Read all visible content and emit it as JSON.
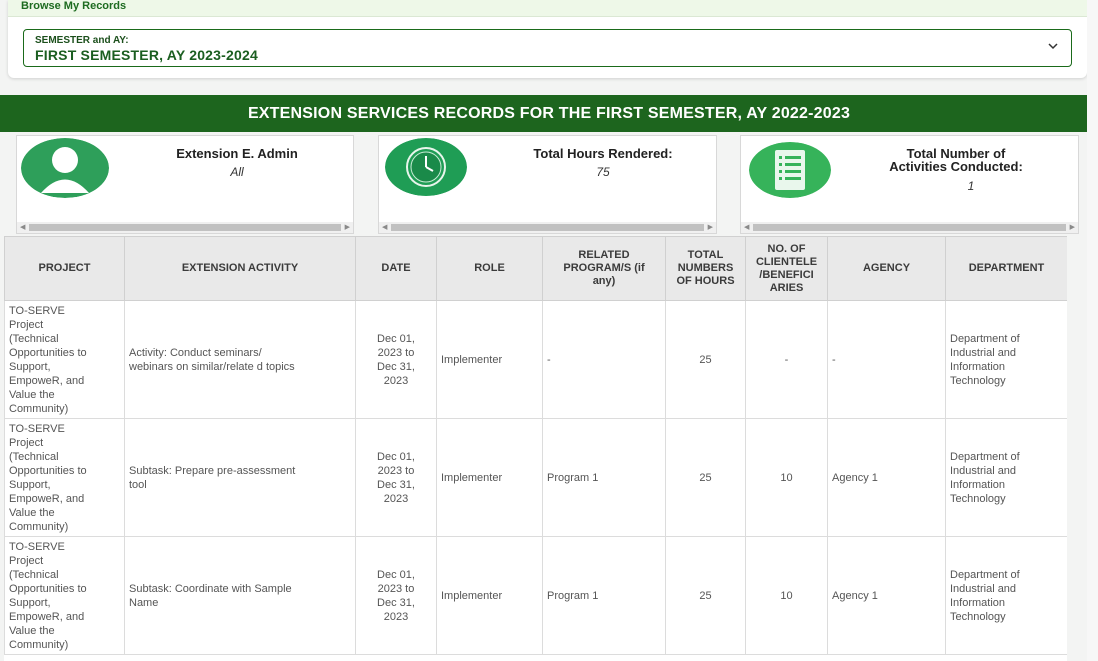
{
  "browse": {
    "title": "Browse My Records"
  },
  "semester": {
    "label": "SEMESTER and AY:",
    "value": "FIRST SEMESTER, AY 2023-2024"
  },
  "banner": {
    "title": "EXTENSION SERVICES RECORDS FOR THE FIRST SEMESTER, AY 2022-2023"
  },
  "stats": {
    "admin": {
      "title": "Extension E. Admin",
      "value": "All",
      "icon": "user-avatar-icon"
    },
    "hours": {
      "title": "Total Hours Rendered:",
      "value": "75",
      "icon": "clock-icon"
    },
    "activities": {
      "title_line1": "Total Number of",
      "title_line2": "Activities Conducted:",
      "value": "1",
      "icon": "document-list-icon"
    }
  },
  "colors": {
    "primary": "#1d651e",
    "accent_green": "#2e9f5a",
    "header_bg": "#e9e9e9"
  },
  "table": {
    "headers": {
      "project": "PROJECT",
      "activity": "EXTENSION ACTIVITY",
      "date": "DATE",
      "role": "ROLE",
      "related_1": "RELATED",
      "related_2": "PROGRAM/S (if",
      "related_3": "any)",
      "hours_1": "TOTAL",
      "hours_2": "NUMBERS",
      "hours_3": "OF HOURS",
      "clients_1": "NO. OF",
      "clients_2": "CLIENTELE",
      "clients_3": "/BENEFICI",
      "clients_4": "ARIES",
      "agency": "AGENCY",
      "department": "DEPARTMENT"
    },
    "rows": [
      {
        "project": [
          "TO-SERVE",
          "Project",
          "(Technical",
          "Opportunities to",
          "Support,",
          "EmpoweR, and",
          "Value the",
          "Community)"
        ],
        "activity": [
          "Activity: Conduct seminars/",
          "webinars on similar/relate d topics"
        ],
        "date": [
          "Dec 01,",
          "2023 to",
          "Dec 31,",
          "2023"
        ],
        "role": "Implementer",
        "program": "-",
        "hours": "25",
        "clients": "-",
        "agency": "-",
        "department": [
          "Department of",
          "Industrial and",
          "Information",
          "Technology"
        ]
      },
      {
        "project": [
          "TO-SERVE",
          "Project",
          "(Technical",
          "Opportunities to",
          "Support,",
          "EmpoweR, and",
          "Value the",
          "Community)"
        ],
        "activity": [
          "Subtask: Prepare pre-assessment",
          "tool"
        ],
        "date": [
          "Dec 01,",
          "2023 to",
          "Dec 31,",
          "2023"
        ],
        "role": "Implementer",
        "program": "Program 1",
        "hours": "25",
        "clients": "10",
        "agency": "Agency 1",
        "department": [
          "Department of",
          "Industrial and",
          "Information",
          "Technology"
        ]
      },
      {
        "project": [
          "TO-SERVE",
          "Project",
          "(Technical",
          "Opportunities to",
          "Support,",
          "EmpoweR, and",
          "Value the",
          "Community)"
        ],
        "activity": [
          "Subtask: Coordinate with Sample",
          "Name"
        ],
        "date": [
          "Dec 01,",
          "2023 to",
          "Dec 31,",
          "2023"
        ],
        "role": "Implementer",
        "program": "Program 1",
        "hours": "25",
        "clients": "10",
        "agency": "Agency 1",
        "department": [
          "Department of",
          "Industrial and",
          "Information",
          "Technology"
        ]
      }
    ]
  }
}
